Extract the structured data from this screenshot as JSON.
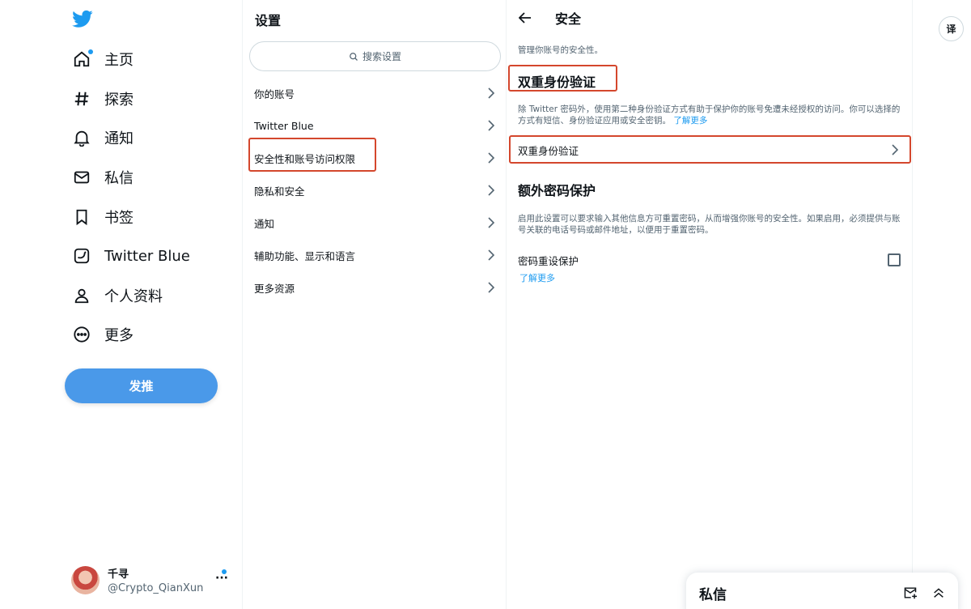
{
  "nav": {
    "items": [
      {
        "label": "主页",
        "icon": "home-icon"
      },
      {
        "label": "探索",
        "icon": "hashtag-icon"
      },
      {
        "label": "通知",
        "icon": "bell-icon"
      },
      {
        "label": "私信",
        "icon": "mail-icon"
      },
      {
        "label": "书签",
        "icon": "bookmark-icon"
      },
      {
        "label": "Twitter Blue",
        "icon": "twitter-blue-icon"
      },
      {
        "label": "个人资料",
        "icon": "person-icon"
      },
      {
        "label": "更多",
        "icon": "more-circle-icon"
      }
    ],
    "tweet_button": "发推",
    "account": {
      "name": "千寻",
      "handle": "@Crypto_QianXun",
      "more": "···"
    }
  },
  "settings": {
    "title": "设置",
    "search_placeholder": "搜索设置",
    "items": [
      "你的账号",
      "Twitter Blue",
      "安全性和账号访问权限",
      "隐私和安全",
      "通知",
      "辅助功能、显示和语言",
      "更多资源"
    ]
  },
  "security": {
    "title": "安全",
    "description": "管理你账号的安全性。",
    "two_factor": {
      "heading": "双重身份验证",
      "text": "除 Twitter 密码外，使用第二种身份验证方式有助于保护你的账号免遭未经授权的访问。你可以选择的方式有短信、身份验证应用或安全密钥。",
      "learn_more": "了解更多",
      "row_label": "双重身份验证"
    },
    "password_protection": {
      "heading": "额外密码保护",
      "text": "启用此设置可以要求输入其他信息方可重置密码，从而增强你账号的安全性。如果启用，必须提供与账号关联的电话号码或邮件地址，以便用于重置密码。",
      "row_label": "密码重设保护",
      "learn_more": "了解更多",
      "checked": false
    }
  },
  "translate_button": "译",
  "dm_drawer": {
    "title": "私信"
  },
  "colors": {
    "accent": "#1d9bf0",
    "highlight": "#d4472d",
    "tweet_button": "#4a99e9"
  }
}
